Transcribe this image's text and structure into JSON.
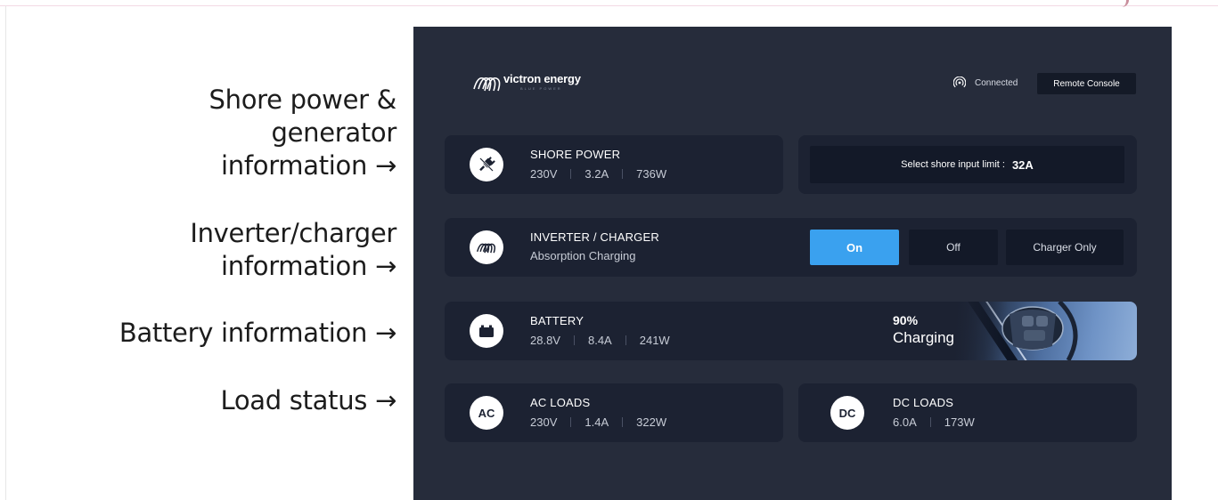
{
  "annotations": [
    {
      "lines": [
        "Shore power &",
        "generator",
        "information →"
      ]
    },
    {
      "lines": [
        "Inverter/charger",
        "information →"
      ]
    },
    {
      "lines": [
        "Battery information →"
      ]
    },
    {
      "lines": [
        "Load status →"
      ]
    }
  ],
  "header": {
    "logo_text": "victron energy",
    "logo_sub": "BLUE POWER",
    "connection_status": "Connected",
    "remote_console_label": "Remote Console"
  },
  "shore_power": {
    "title": "SHORE POWER",
    "voltage": "230V",
    "current": "3.2A",
    "power": "736W",
    "limit_label": "Select shore input limit :",
    "limit_value": "32A"
  },
  "inverter": {
    "title": "INVERTER / CHARGER",
    "state": "Absorption Charging",
    "modes": [
      "On",
      "Off",
      "Charger Only"
    ],
    "active_mode": "On"
  },
  "battery": {
    "title": "BATTERY",
    "voltage": "28.8V",
    "current": "8.4A",
    "power": "241W",
    "soc": "90%",
    "state": "Charging"
  },
  "ac_loads": {
    "title": "AC LOADS",
    "icon_text": "AC",
    "voltage": "230V",
    "current": "1.4A",
    "power": "322W"
  },
  "dc_loads": {
    "title": "DC LOADS",
    "icon_text": "DC",
    "current": "6.0A",
    "power": "173W"
  },
  "colors": {
    "panel_bg": "#262c3b",
    "card_bg": "#1c2232",
    "accent": "#3aa1ef"
  }
}
